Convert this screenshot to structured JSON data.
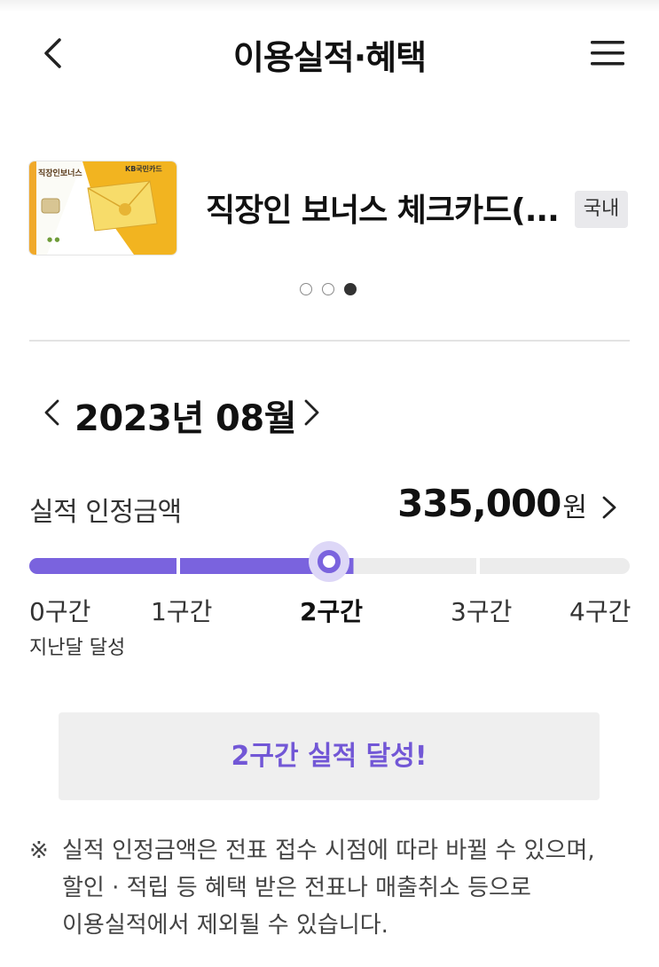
{
  "header": {
    "title": "이용실적·혜택"
  },
  "card": {
    "name": "직장인 보너스 체크카드(...",
    "region_badge": "국내",
    "image_brand": "KB국민카드",
    "image_title": "직장인보너스",
    "carousel": {
      "total": 3,
      "active": 3
    }
  },
  "period": {
    "label": "2023년 08월"
  },
  "performance": {
    "label": "실적 인정금액",
    "amount": "335,000",
    "unit": "원"
  },
  "tiers": {
    "items": [
      "0구간",
      "1구간",
      "2구간",
      "3구간",
      "4구간"
    ],
    "current_index": 2,
    "last_month_note": "지난달 달성",
    "progress_fraction": 0.54,
    "fill_color": "#7a63de",
    "track_color": "#ececec"
  },
  "achievement": {
    "message": "2구간 실적 달성!"
  },
  "notice": {
    "mark": "※",
    "lines": [
      "실적 인정금액은 전표 접수 시점에 따라 바뀔 수 있으며,",
      "할인 · 적립 등 혜택 받은 전표나 매출취소 등으로",
      "이용실적에서 제외될 수 있습니다."
    ]
  },
  "icons": {
    "back": "chevron-left-icon",
    "menu": "hamburger-menu-icon",
    "prev_month": "chevron-left-icon",
    "next_month": "chevron-right-icon",
    "amount_detail": "chevron-right-icon"
  }
}
